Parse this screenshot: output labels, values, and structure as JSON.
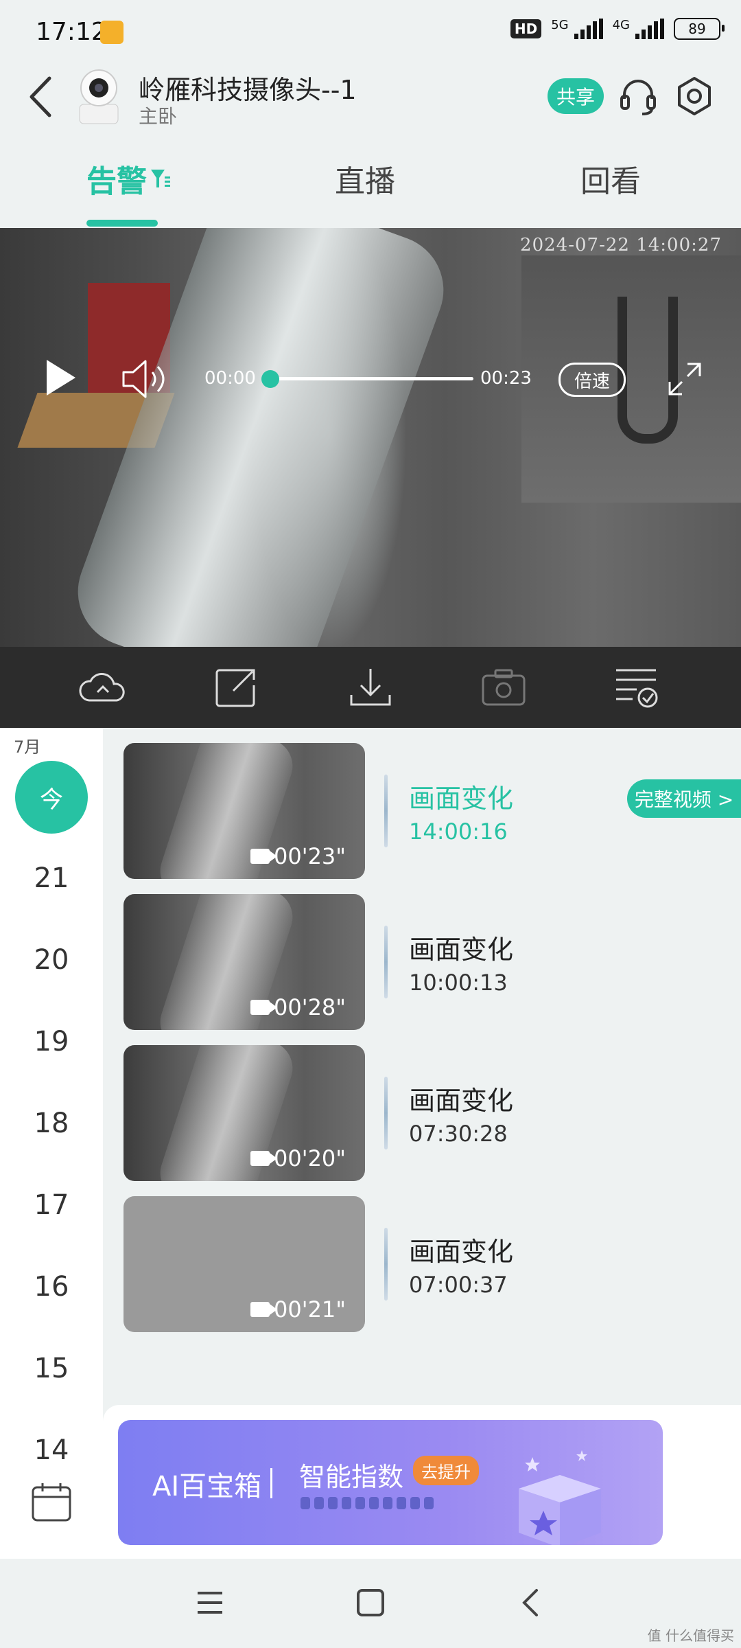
{
  "status_bar": {
    "time": "17:12",
    "hd_label": "HD",
    "net1": "5G",
    "net2": "4G",
    "battery": "89"
  },
  "header": {
    "device_name": "岭雁科技摄像头--1",
    "room": "主卧",
    "share_label": "共享"
  },
  "tabs": {
    "alert": "告警",
    "live": "直播",
    "replay": "回看",
    "active": "alert"
  },
  "video": {
    "timestamp": "2024-07-22 14:00:27",
    "current_time": "00:00",
    "duration": "00:23",
    "progress": 0.0,
    "speed_label": "倍速"
  },
  "toolbar": {
    "icons": [
      "cloud-icon",
      "share-icon",
      "download-icon",
      "camera-icon",
      "list-check-icon"
    ]
  },
  "dates": {
    "month": "7月",
    "today": "今",
    "days": [
      "21",
      "20",
      "19",
      "18",
      "17",
      "16",
      "15",
      "14"
    ]
  },
  "events": [
    {
      "title": "画面变化",
      "time": "14:00:16",
      "duration": "00'23\"",
      "active": true
    },
    {
      "title": "画面变化",
      "time": "10:00:13",
      "duration": "00'28\"",
      "active": false
    },
    {
      "title": "画面变化",
      "time": "07:30:28",
      "duration": "00'20\"",
      "active": false
    },
    {
      "title": "画面变化",
      "time": "07:00:37",
      "duration": "00'21\"",
      "active": false
    }
  ],
  "full_video_label": "完整视频 >",
  "banner": {
    "title": "AI百宝箱",
    "subtitle": "智能指数",
    "badge": "去提升"
  },
  "watermark": "值 什么值得买",
  "colors": {
    "accent": "#27c2a3",
    "toolbar_bg": "#2c2c2c",
    "page_bg": "#eef2f2"
  }
}
